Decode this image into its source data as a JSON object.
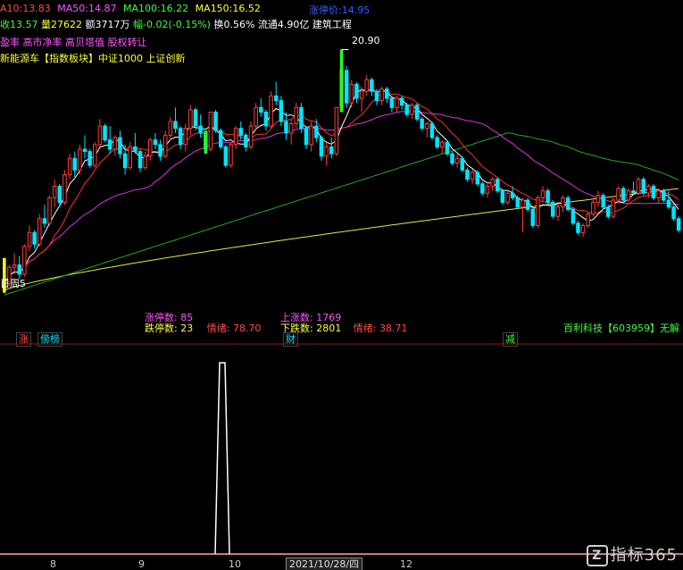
{
  "header": {
    "ma10_label": "A10:",
    "ma10_value": "13.83",
    "ma50_label": "MA50:",
    "ma50_value": "14.87",
    "ma100_label": "MA100:",
    "ma100_value": "16.22",
    "ma150_label": "MA150:",
    "ma150_value": "16.52",
    "limit_up_label": "涨停价:",
    "limit_up_value": "14.95"
  },
  "info_row": {
    "close": "收13.57",
    "volume": "量27622",
    "amount": "额3717万",
    "change": "幅-0.02(-0.15%)",
    "turnover": "换0.56%",
    "float": "流通4.90亿",
    "industry": "建筑工程"
  },
  "concepts_row1": "盈率 高市净率 高贝塔值 股权转让",
  "concepts_row2": "新能源车【指数板块】中证1000 上证创新",
  "price_high_label": "20.90",
  "left_marker": "日周5",
  "stats": {
    "limit_up_count_label": "涨停数:",
    "limit_up_count": "85",
    "limit_down_count_label": "跌停数:",
    "limit_down_count": "23",
    "sentiment1_label": "情绪:",
    "sentiment1": "78.70",
    "up_count_label": "上涨数:",
    "up_count": "1769",
    "down_count_label": "下跌数:",
    "down_count": "2801",
    "sentiment2_label": "情绪:",
    "sentiment2": "38.71"
  },
  "tags": {
    "rise": "涨",
    "ranking": "傍榜",
    "finance": "财",
    "reduce": "减"
  },
  "stock_name": "百利科技【603959】无解",
  "x_axis": [
    "8",
    "9",
    "10",
    "12"
  ],
  "cursor_date": "2021/10/28/四",
  "watermark": {
    "logo": "Z",
    "text": "指标365"
  },
  "colors": {
    "up": "#ff3c3c",
    "down": "#00e5ff",
    "ma_white": "#ffffff",
    "ma_red": "#ff3030",
    "ma_magenta": "#dd33dd",
    "ma_green": "#22aa22",
    "ma_yellow": "#e6e64a",
    "limit_up_bar": "#22ff22",
    "limit_bar_yellow": "#ffff00"
  },
  "chart_data": {
    "type": "candlestick",
    "title": "",
    "bars": [
      [
        10.6,
        10.9,
        10.4,
        10.8
      ],
      [
        10.8,
        11.6,
        10.7,
        11.5
      ],
      [
        11.5,
        12.1,
        11.2,
        11.6
      ],
      [
        11.6,
        12.0,
        11.0,
        11.2
      ],
      [
        11.2,
        12.5,
        11.1,
        12.4
      ],
      [
        12.4,
        13.3,
        12.2,
        13.0
      ],
      [
        13.0,
        13.1,
        12.3,
        12.5
      ],
      [
        12.5,
        13.8,
        12.4,
        13.6
      ],
      [
        13.6,
        14.2,
        13.2,
        13.4
      ],
      [
        13.4,
        14.6,
        13.3,
        14.5
      ],
      [
        14.5,
        15.3,
        14.1,
        15.0
      ],
      [
        15.0,
        15.1,
        14.1,
        14.3
      ],
      [
        14.3,
        15.7,
        14.2,
        15.5
      ],
      [
        15.5,
        16.4,
        15.3,
        16.2
      ],
      [
        16.2,
        16.5,
        15.4,
        15.7
      ],
      [
        15.7,
        16.8,
        15.5,
        16.6
      ],
      [
        16.6,
        17.2,
        16.2,
        16.5
      ],
      [
        16.5,
        16.6,
        15.8,
        15.9
      ],
      [
        15.9,
        16.9,
        15.8,
        16.8
      ],
      [
        16.8,
        17.9,
        16.7,
        17.6
      ],
      [
        17.6,
        17.7,
        16.9,
        17.0
      ],
      [
        17.0,
        17.6,
        16.4,
        16.6
      ],
      [
        16.6,
        17.2,
        16.3,
        17.1
      ],
      [
        17.1,
        17.4,
        16.2,
        16.4
      ],
      [
        16.4,
        16.8,
        15.5,
        15.8
      ],
      [
        15.8,
        16.9,
        15.7,
        16.7
      ],
      [
        16.7,
        17.3,
        16.4,
        16.5
      ],
      [
        16.5,
        16.6,
        15.6,
        15.8
      ],
      [
        15.8,
        16.5,
        15.7,
        16.3
      ],
      [
        16.3,
        17.1,
        16.1,
        17.0
      ],
      [
        17.0,
        17.3,
        16.6,
        16.8
      ],
      [
        16.8,
        17.0,
        16.1,
        16.3
      ],
      [
        16.3,
        17.4,
        16.2,
        17.2
      ],
      [
        17.2,
        18.0,
        17.0,
        17.8
      ],
      [
        17.8,
        18.4,
        17.3,
        17.5
      ],
      [
        17.5,
        17.6,
        16.6,
        16.8
      ],
      [
        16.8,
        17.7,
        16.5,
        17.5
      ],
      [
        17.5,
        18.5,
        17.2,
        18.3
      ],
      [
        18.3,
        18.4,
        17.4,
        17.6
      ],
      [
        17.6,
        18.1,
        17.1,
        17.3
      ],
      [
        17.3,
        17.4,
        16.4,
        16.6
      ],
      [
        16.6,
        18.2,
        16.5,
        18.2
      ],
      [
        18.2,
        18.3,
        17.3,
        17.4
      ],
      [
        17.4,
        17.5,
        16.6,
        16.7
      ],
      [
        16.7,
        16.8,
        15.8,
        15.9
      ],
      [
        15.9,
        16.9,
        15.8,
        16.8
      ],
      [
        16.8,
        17.6,
        16.6,
        17.5
      ],
      [
        17.5,
        17.8,
        17.0,
        17.2
      ],
      [
        17.2,
        17.3,
        16.5,
        16.7
      ],
      [
        16.7,
        17.8,
        16.6,
        17.6
      ],
      [
        17.6,
        18.6,
        17.4,
        18.4
      ],
      [
        18.4,
        18.8,
        18.0,
        18.2
      ],
      [
        18.2,
        18.3,
        17.4,
        17.6
      ],
      [
        17.6,
        19.1,
        17.5,
        18.9
      ],
      [
        18.9,
        19.5,
        18.5,
        18.7
      ],
      [
        18.7,
        18.9,
        17.6,
        17.8
      ],
      [
        17.8,
        18.2,
        17.0,
        17.3
      ],
      [
        17.3,
        17.9,
        16.8,
        17.7
      ],
      [
        17.7,
        18.6,
        17.5,
        18.4
      ],
      [
        18.4,
        18.6,
        17.3,
        17.5
      ],
      [
        17.5,
        17.6,
        16.6,
        16.8
      ],
      [
        16.8,
        17.8,
        16.5,
        17.6
      ],
      [
        17.6,
        17.9,
        16.9,
        17.1
      ],
      [
        17.1,
        17.2,
        16.1,
        16.3
      ],
      [
        16.3,
        16.9,
        15.9,
        16.7
      ],
      [
        16.7,
        17.1,
        16.2,
        16.4
      ],
      [
        16.4,
        18.4,
        16.3,
        18.4
      ],
      [
        18.4,
        20.9,
        18.2,
        20.0
      ],
      [
        20.0,
        20.2,
        18.4,
        18.6
      ],
      [
        18.6,
        19.6,
        18.4,
        19.4
      ],
      [
        19.4,
        19.5,
        18.6,
        18.8
      ],
      [
        18.8,
        19.3,
        18.2,
        19.1
      ],
      [
        19.1,
        19.8,
        18.9,
        19.6
      ],
      [
        19.6,
        19.7,
        18.9,
        19.1
      ],
      [
        19.1,
        19.2,
        18.5,
        18.7
      ],
      [
        18.7,
        19.3,
        18.5,
        19.2
      ],
      [
        19.2,
        19.3,
        18.6,
        18.8
      ],
      [
        18.8,
        18.9,
        18.2,
        18.4
      ],
      [
        18.4,
        18.9,
        18.2,
        18.8
      ],
      [
        18.8,
        18.9,
        18.3,
        18.5
      ],
      [
        18.5,
        18.6,
        18.0,
        18.1
      ],
      [
        18.1,
        18.6,
        17.9,
        18.5
      ],
      [
        18.5,
        18.6,
        17.8,
        17.9
      ],
      [
        17.9,
        18.0,
        17.4,
        17.5
      ],
      [
        17.5,
        17.8,
        17.1,
        17.7
      ],
      [
        17.7,
        17.8,
        17.0,
        17.1
      ],
      [
        17.1,
        17.2,
        16.6,
        16.7
      ],
      [
        16.7,
        17.0,
        16.4,
        16.9
      ],
      [
        16.9,
        17.0,
        16.3,
        16.4
      ],
      [
        16.4,
        16.5,
        15.9,
        16.0
      ],
      [
        16.0,
        16.4,
        15.8,
        16.2
      ],
      [
        16.2,
        16.3,
        15.6,
        15.7
      ],
      [
        15.7,
        15.8,
        15.2,
        15.3
      ],
      [
        15.3,
        15.7,
        15.1,
        15.6
      ],
      [
        15.6,
        15.7,
        15.0,
        15.1
      ],
      [
        15.1,
        15.2,
        14.6,
        14.7
      ],
      [
        14.7,
        15.1,
        14.5,
        15.0
      ],
      [
        15.0,
        15.4,
        14.8,
        15.3
      ],
      [
        15.3,
        15.4,
        14.7,
        14.8
      ],
      [
        14.8,
        14.9,
        14.2,
        14.3
      ],
      [
        14.3,
        14.8,
        14.2,
        14.7
      ],
      [
        14.7,
        15.0,
        14.4,
        14.5
      ],
      [
        14.5,
        14.6,
        14.0,
        14.1
      ],
      [
        14.1,
        14.5,
        13.0,
        14.4
      ],
      [
        14.4,
        14.5,
        13.9,
        14.0
      ],
      [
        14.0,
        14.1,
        13.2,
        13.3
      ],
      [
        13.3,
        14.6,
        13.2,
        14.5
      ],
      [
        14.5,
        15.0,
        14.3,
        14.8
      ],
      [
        14.8,
        14.9,
        14.2,
        14.3
      ],
      [
        14.3,
        14.4,
        13.6,
        13.7
      ],
      [
        13.7,
        14.2,
        13.5,
        14.1
      ],
      [
        14.1,
        14.6,
        13.9,
        14.5
      ],
      [
        14.5,
        14.6,
        13.9,
        14.0
      ],
      [
        14.0,
        14.1,
        13.3,
        13.4
      ],
      [
        13.4,
        13.5,
        12.9,
        13.0
      ],
      [
        13.0,
        13.4,
        12.8,
        13.3
      ],
      [
        13.3,
        13.9,
        13.2,
        13.8
      ],
      [
        13.8,
        14.4,
        13.7,
        14.3
      ],
      [
        14.3,
        14.8,
        14.1,
        14.6
      ],
      [
        14.6,
        14.7,
        14.0,
        14.1
      ],
      [
        14.1,
        14.2,
        13.6,
        13.7
      ],
      [
        13.7,
        14.5,
        13.6,
        14.4
      ],
      [
        14.4,
        15.0,
        14.3,
        14.9
      ],
      [
        14.9,
        15.0,
        14.3,
        14.4
      ],
      [
        14.4,
        14.9,
        14.3,
        14.8
      ],
      [
        14.8,
        15.2,
        14.6,
        14.7
      ],
      [
        14.7,
        15.4,
        14.6,
        15.3
      ],
      [
        15.3,
        15.4,
        14.6,
        14.7
      ],
      [
        14.7,
        15.1,
        14.5,
        15.0
      ],
      [
        15.0,
        15.1,
        14.4,
        14.5
      ],
      [
        14.5,
        14.9,
        14.3,
        14.8
      ],
      [
        14.8,
        14.9,
        14.3,
        14.4
      ],
      [
        14.4,
        14.8,
        14.0,
        14.1
      ],
      [
        14.1,
        14.2,
        13.5,
        13.6
      ],
      [
        13.6,
        13.7,
        13.0,
        13.1
      ]
    ],
    "ylim": [
      10,
      21.5
    ],
    "indicator": {
      "type": "spike",
      "bar_index": 40,
      "value": 1,
      "ylim": [
        0,
        1
      ]
    },
    "x_axis_labels": [
      "8",
      "9",
      "10",
      "12"
    ]
  }
}
